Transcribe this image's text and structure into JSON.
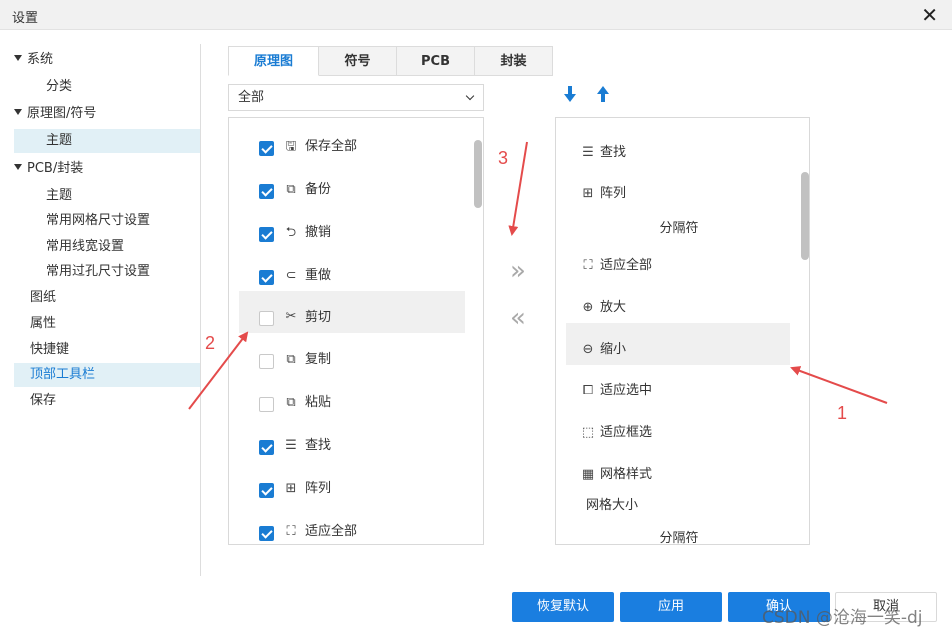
{
  "window": {
    "title": "设置",
    "close_glyph": "✕"
  },
  "sidebar": {
    "items": [
      {
        "label": "系统",
        "caret": true,
        "indent": 0
      },
      {
        "label": "分类",
        "caret": false,
        "indent": 2
      },
      {
        "label": "原理图/符号",
        "caret": true,
        "indent": 0
      },
      {
        "label": "主题",
        "caret": false,
        "indent": 2,
        "selected": true
      },
      {
        "label": "PCB/封装",
        "caret": true,
        "indent": 0
      },
      {
        "label": "主题",
        "caret": false,
        "indent": 2
      },
      {
        "label": "常用网格尺寸设置",
        "caret": false,
        "indent": 2
      },
      {
        "label": "常用线宽设置",
        "caret": false,
        "indent": 2
      },
      {
        "label": "常用过孔尺寸设置",
        "caret": false,
        "indent": 2
      },
      {
        "label": "图纸",
        "caret": false,
        "indent": 1
      },
      {
        "label": "属性",
        "caret": false,
        "indent": 1
      },
      {
        "label": "快捷键",
        "caret": false,
        "indent": 1
      },
      {
        "label": "顶部工具栏",
        "caret": false,
        "indent": 1,
        "active": true
      },
      {
        "label": "保存",
        "caret": false,
        "indent": 1
      }
    ]
  },
  "tabs": [
    {
      "label": "原理图",
      "active": true
    },
    {
      "label": "符号"
    },
    {
      "label": "PCB"
    },
    {
      "label": "封装"
    }
  ],
  "filter": {
    "value": "全部"
  },
  "available": {
    "items": [
      {
        "label": "保存全部",
        "checked": true,
        "icon": "save-all-icon"
      },
      {
        "label": "备份",
        "checked": true,
        "icon": "backup-icon"
      },
      {
        "label": "撤销",
        "checked": true,
        "icon": "undo-icon"
      },
      {
        "label": "重做",
        "checked": true,
        "icon": "redo-icon"
      },
      {
        "label": "剪切",
        "checked": false,
        "icon": "cut-icon",
        "hover": true
      },
      {
        "label": "复制",
        "checked": false,
        "icon": "copy-icon"
      },
      {
        "label": "粘贴",
        "checked": false,
        "icon": "paste-icon"
      },
      {
        "label": "查找",
        "checked": true,
        "icon": "find-icon"
      },
      {
        "label": "阵列",
        "checked": true,
        "icon": "array-icon"
      },
      {
        "label": "适应全部",
        "checked": true,
        "icon": "fit-all-icon"
      }
    ]
  },
  "selected_list": {
    "items": [
      {
        "label": "查找",
        "type": "item",
        "icon": "find-icon"
      },
      {
        "label": "阵列",
        "type": "item",
        "icon": "array-icon"
      },
      {
        "label": "分隔符",
        "type": "separator"
      },
      {
        "label": "适应全部",
        "type": "item",
        "icon": "fit-all-icon"
      },
      {
        "label": "放大",
        "type": "item",
        "icon": "zoom-in-icon"
      },
      {
        "label": "缩小",
        "type": "item",
        "icon": "zoom-out-icon",
        "hover": true
      },
      {
        "label": "适应选中",
        "type": "item",
        "icon": "fit-selected-icon"
      },
      {
        "label": "适应框选",
        "type": "item",
        "icon": "fit-box-icon"
      },
      {
        "label": "网格样式",
        "type": "item",
        "icon": "grid-style-icon"
      },
      {
        "label": "网格大小",
        "type": "plain"
      },
      {
        "label": "分隔符",
        "type": "separator"
      }
    ]
  },
  "move": {
    "add": "»",
    "remove": "«"
  },
  "buttons": {
    "restore": "恢复默认",
    "apply": "应用",
    "ok": "确认",
    "cancel": "取消"
  },
  "annotations": [
    "1",
    "2",
    "3"
  ],
  "watermark": "CSDN @沧海一笑-dj",
  "colors": {
    "accent": "#1a7cd3",
    "button": "#1a7ee0",
    "annotation": "#e44b4b"
  }
}
